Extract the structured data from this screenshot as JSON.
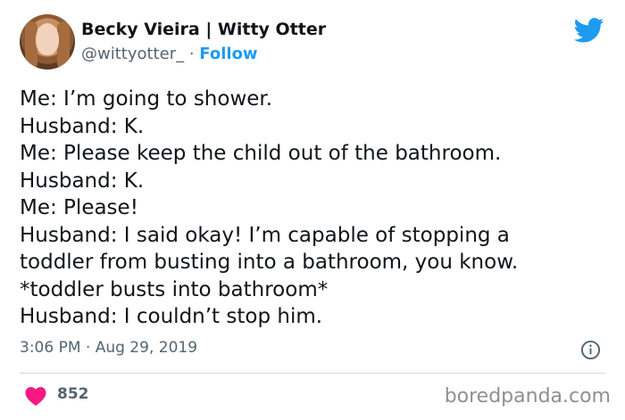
{
  "author": {
    "name": "Becky Vieira | Witty Otter",
    "handle": "@wittyotter_",
    "separator": "·",
    "follow_label": "Follow"
  },
  "tweet": {
    "lines": [
      "Me: I’m going to shower.",
      "Husband: K.",
      "Me: Please keep the child out of the bathroom.",
      "Husband: K.",
      "Me: Please!",
      "Husband: I said okay! I’m capable of stopping a",
      "toddler from busting into a bathroom, you know.",
      "*toddler busts into bathroom*",
      "Husband: I couldn’t stop him."
    ],
    "timestamp": "3:06 PM · Aug 29, 2019",
    "likes": "852"
  },
  "watermark": "boredpanda.com",
  "icons": {
    "brand": "twitter-bird-icon",
    "info": "info-icon",
    "like": "heart-icon"
  },
  "colors": {
    "accent": "#1d9bf0",
    "heart": "#f91880",
    "muted": "#536471"
  }
}
